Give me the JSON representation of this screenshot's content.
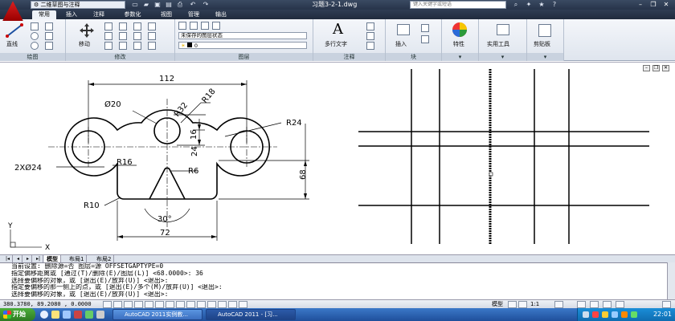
{
  "titlebar": {
    "workspace": "二维草图与注释",
    "document_title": "习题3-2-1.dwg",
    "help_search_placeholder": "键入关键字或短语"
  },
  "ribbon_tabs": [
    "常用",
    "插入",
    "注释",
    "参数化",
    "视图",
    "管理",
    "输出"
  ],
  "panels": {
    "draw": {
      "title": "绘图",
      "line_label": "直线"
    },
    "modify": {
      "title": "修改",
      "move_label": "移动"
    },
    "layers": {
      "title": "图层",
      "layer_state": "未保存的图层状态",
      "current_layer": "0"
    },
    "annotation": {
      "title": "注释",
      "mtext_label": "多行文字"
    },
    "block": {
      "title": "块",
      "insert_label": "插入"
    },
    "properties": {
      "label": "特性"
    },
    "utilities": {
      "label": "实用工具"
    },
    "clipboard": {
      "label": "剪贴板"
    }
  },
  "drawing": {
    "dims": {
      "d112": "112",
      "d20": "Ø20",
      "r32": "R32",
      "r18": "R18",
      "r24": "R24",
      "d16": "16",
      "d24": "24",
      "d68": "68",
      "d2x24": "2XØ24",
      "r16": "R16",
      "r6": "R6",
      "r10": "R10",
      "a30": "30°",
      "d72": "72"
    },
    "ucs": {
      "x": "X",
      "y": "Y"
    }
  },
  "layout_tabs": [
    "模型",
    "布局1",
    "布局2"
  ],
  "command_lines": [
    "当前设置: 删除源=否  图层=源  OFFSETGAPTYPE=0",
    "指定偏移距离或 [通过(T)/删除(E)/图层(L)] <68.0000>:  36",
    "选择要偏移的对象，或 [退出(E)/放弃(U)] <退出>:",
    "指定要偏移的那一侧上的点，或 [退出(E)/多个(M)/放弃(U)] <退出>:",
    "选择要偏移的对象，或 [退出(E)/放弃(U)] <退出>:"
  ],
  "statusbar": {
    "coords": "380.3780, 89.2080 , 0.0000",
    "model_label": "模型",
    "scale": "1:1"
  },
  "taskbar": {
    "start_label": "开始",
    "tasks": [
      "AutoCAD 2011实例教...",
      "AutoCAD 2011 - [习..."
    ],
    "clock": "22:01"
  }
}
